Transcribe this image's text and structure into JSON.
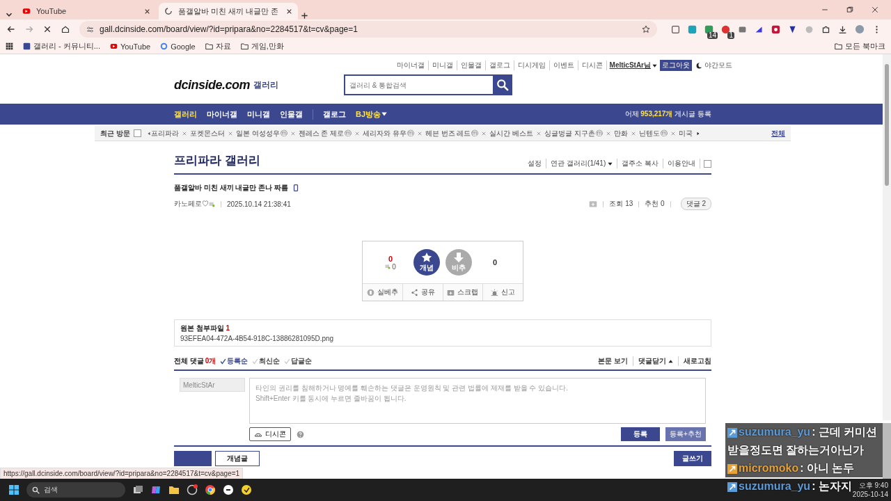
{
  "browser": {
    "tabs": [
      {
        "title": "YouTube",
        "selected": false
      },
      {
        "title": "품갤알바 미친 새끼 내글만 존",
        "selected": true
      }
    ],
    "url": "gall.dcinside.com/board/view/?id=pripara&no=2284517&t=cv&page=1",
    "extension_badges": [
      "14",
      "1"
    ],
    "bookmarks": [
      "갤러리 - 커뮤니티...",
      "YouTube",
      "Google",
      "자료",
      "게임,만화"
    ],
    "all_bookmarks": "모든 북마크"
  },
  "page": {
    "top_links": [
      "마이너갤",
      "미니갤",
      "인물갤",
      "갤로그",
      "디시게임",
      "이벤트",
      "디시콘"
    ],
    "user": "MelticStAr님",
    "logout": "로그아웃",
    "night_mode": "야간모드",
    "logo": "dcinside.com",
    "logo_sub": "갤러리",
    "search_placeholder": "갤러리 & 통합검색",
    "nav_groups": [
      [
        {
          "label": "갤러리",
          "highlighted": true
        },
        {
          "label": "마이너갤",
          "highlighted": false
        },
        {
          "label": "미니갤",
          "highlighted": false
        },
        {
          "label": "인물갤",
          "highlighted": false
        }
      ],
      [
        {
          "label": "갤로그",
          "highlighted": false
        },
        {
          "label": "BJ방송",
          "highlighted": true
        }
      ]
    ],
    "daily_count": "어제 **953,217개** 게시글 등록",
    "recent": {
      "label": "최근 방문",
      "items": [
        {
          "name": "프리파라"
        },
        {
          "name": "포켓몬스터"
        },
        {
          "name": "일본 여성성우",
          "mark": "ⓜ"
        },
        {
          "name": "젠레스 존 제로",
          "mark": "ⓜ"
        },
        {
          "name": "세리자와 유우",
          "mark": "ⓜ"
        },
        {
          "name": "헤븐 번즈 레드",
          "mark": "ⓜ"
        },
        {
          "name": "실시간 베스트"
        },
        {
          "name": "싱글벙글 지구촌",
          "mark": "ⓜ"
        },
        {
          "name": "만화"
        },
        {
          "name": "닌텐도",
          "mark": "ⓜ"
        },
        {
          "name": "미국"
        }
      ],
      "all": "전체"
    },
    "gallery_title": "프리파라 갤러리",
    "gallery_links": [
      "설정",
      "연관 갤러리(1/41)",
      "갤주소 복사",
      "이용안내"
    ],
    "post": {
      "title": "품갤알바 미친 새끼 내글만 존나 짜름",
      "nickname": "카노페로♡",
      "date": "2025.10.14 21:38:41",
      "views": "조회 13",
      "recommend": "추천 0",
      "comments": "댓글 2"
    },
    "vote": {
      "up_count": "0",
      "fixed_count": "0",
      "up_label": "개념",
      "down_label": "비추",
      "down_count": "0",
      "actions": [
        "실베추",
        "공유",
        "스크랩",
        "신고"
      ]
    },
    "attachment": {
      "label": "원본 첨부파일",
      "count": "1",
      "file": "93EFEA04-472A-4B54-918C-13886281095D.png"
    },
    "comments": {
      "label": "전체 댓글",
      "count": "0개",
      "sorts": [
        {
          "label": "등록순",
          "selected": true
        },
        {
          "label": "최신순",
          "selected": false
        },
        {
          "label": "답글순",
          "selected": false
        }
      ],
      "links": [
        "본문 보기",
        "댓글닫기",
        "새로고침"
      ],
      "name_value": "MelticStAr",
      "placeholder": "타인의 권리를 침해하거나 명예를 훼손하는 댓글은 운영원칙 및 관련 법률에 제재를 받을 수 있습니다.\nShift+Enter 키를 동시에 누르면 줄바꿈이 됩니다.",
      "dccon": "디시콘",
      "submit": "등록",
      "submit_recommend": "등록+추천"
    },
    "bottom_buttons": [
      "개념글"
    ],
    "write": "글쓰기"
  },
  "status_url": "https://gall.dcinside.com/board/view/?id=pripara&no=2284517&t=cv&page=1",
  "taskbar": {
    "search": "검색",
    "time": "오후 9:40",
    "date": "2025-10-14"
  },
  "chat": [
    {
      "user": "suzumura_yu",
      "message": ": 근데 커미션 받을정도면 잘하는거아닌가",
      "color": "#5b9bd8"
    },
    {
      "user": "micromoko",
      "message": ": 아니 논두",
      "color": "#e8a23a"
    },
    {
      "user": "suzumura_yu",
      "message": ": 논자지",
      "color": "#5b9bd8"
    }
  ]
}
